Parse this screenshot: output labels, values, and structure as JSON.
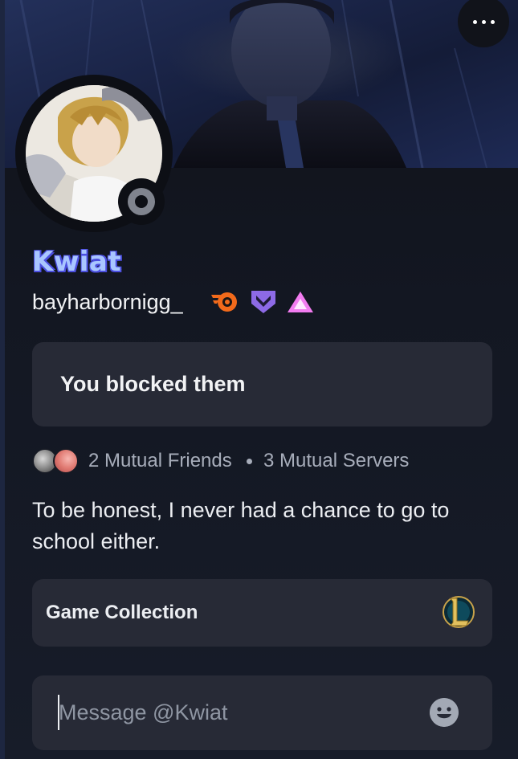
{
  "profile": {
    "display_name": "Kwiat",
    "username": "bayharbornigg_",
    "status": "offline",
    "badges": [
      "flame-badge-icon",
      "shield-chevron-badge-icon",
      "triangle-badge-icon"
    ]
  },
  "notice": {
    "blocked_text": "You blocked them"
  },
  "mutuals": {
    "friends_label": "2 Mutual Friends",
    "servers_label": "3 Mutual Servers"
  },
  "bio": {
    "text": "To be honest, I never had a chance to go to school either."
  },
  "game_collection": {
    "label": "Game Collection",
    "game_icon": "league-of-legends-icon"
  },
  "message": {
    "placeholder": "Message @Kwiat",
    "value": ""
  },
  "colors": {
    "card_bg": "#272a36",
    "display_name": "#a9c6ff",
    "status_offline": "#80848e",
    "muted_text": "#a7adba"
  }
}
